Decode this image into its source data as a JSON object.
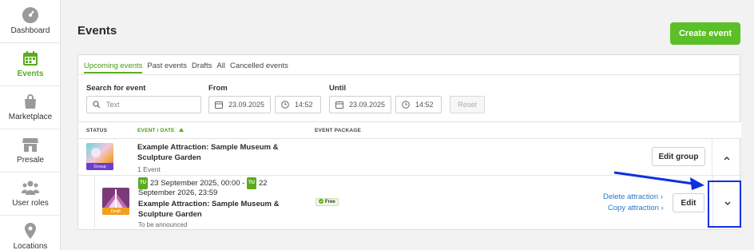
{
  "sidebar": {
    "items": [
      {
        "label": "Dashboard",
        "icon": "dashboard-icon"
      },
      {
        "label": "Events",
        "icon": "calendar-icon",
        "active": true
      },
      {
        "label": "Marketplace",
        "icon": "bag-icon"
      },
      {
        "label": "Presale",
        "icon": "store-icon"
      },
      {
        "label": "User roles",
        "icon": "users-icon"
      },
      {
        "label": "Locations",
        "icon": "location-pin-icon"
      }
    ]
  },
  "header": {
    "title": "Events",
    "create_label": "Create event"
  },
  "tabs": [
    "Upcoming events",
    "Past events",
    "Drafts",
    "All",
    "Cancelled events"
  ],
  "filters": {
    "search_label": "Search for event",
    "search_placeholder": "Text",
    "from_label": "From",
    "from_date": "23.09.2025",
    "from_time": "14:52",
    "until_label": "Until",
    "until_date": "23.09.2025",
    "until_time": "14:52",
    "reset_label": "Reset"
  },
  "table": {
    "columns": {
      "status": "STATUS",
      "event_date": "EVENT / DATE",
      "package": "EVENT PACKAGE"
    }
  },
  "group_row": {
    "tag": "Group",
    "name_line1": "Example Attraction: Sample Museum &",
    "name_line2": "Sculpture Garden",
    "count": "1 Event",
    "edit_label": "Edit group"
  },
  "attraction_row": {
    "tag": "Draft",
    "day1": "TU",
    "date_part1": "23 September 2025, 00:00 -",
    "day2": "TU",
    "date_part2": "22",
    "date_line2": "September 2026, 23:59",
    "name_line1": "Example Attraction: Sample Museum &",
    "name_line2": "Sculpture Garden",
    "subtitle": "To be announced",
    "package_badge": "Free",
    "delete_label": "Delete attraction",
    "copy_label": "Copy attraction",
    "edit_label": "Edit"
  },
  "colors": {
    "accent": "#5aab1e",
    "button_green": "#5bbf28",
    "link": "#2a78c8",
    "annotation": "#1030e0"
  }
}
